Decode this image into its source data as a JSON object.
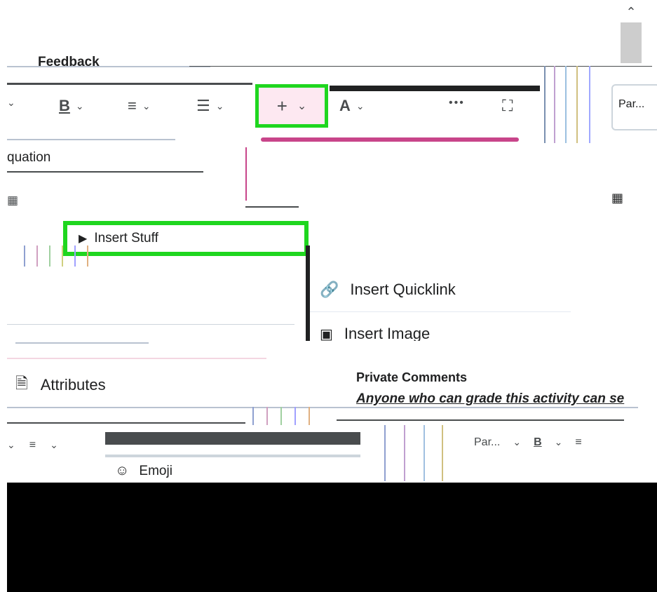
{
  "feedback": {
    "title": "Feedback"
  },
  "toolbar": {
    "bold_label": "B",
    "insert_label": "+",
    "font_label": "A",
    "more_label": "•••",
    "expand_label": "⛶",
    "format_value": "Par..."
  },
  "left_menu": {
    "equation_label": "quation",
    "insert_stuff_label": "Insert Stuff"
  },
  "insert_menu": {
    "items": [
      {
        "label": "Insert Quicklink"
      },
      {
        "label": "Insert Image"
      }
    ]
  },
  "sidebar": {
    "attributes_label": "Attributes"
  },
  "private_comments": {
    "title": "Private Comments",
    "description": "Anyone who can grade this activity can se"
  },
  "bottom_menu": {
    "emoji_label": "Emoji",
    "format_value": "Par..."
  },
  "icons": {
    "scroll_up": "chevron-up-icon",
    "insert_stuff": "play-icon",
    "quicklink": "link-icon",
    "image": "image-icon",
    "attributes": "attributes-icon",
    "emoji": "emoji-icon"
  },
  "colors": {
    "highlight": "#1fd61f",
    "text": "#202122",
    "icon": "#494c4e"
  }
}
